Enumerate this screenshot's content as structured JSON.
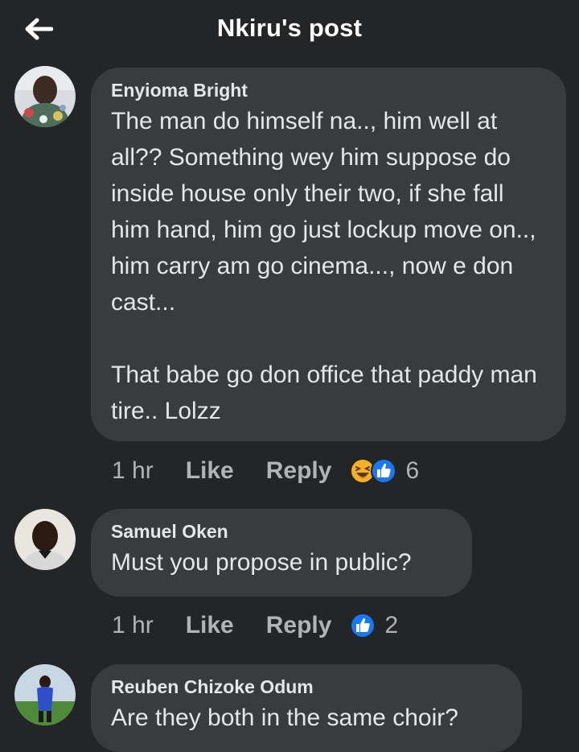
{
  "header": {
    "title": "Nkiru's post",
    "back_icon": "arrow-left-icon"
  },
  "colors": {
    "background": "#242527",
    "bubble": "#3a3b3d",
    "text": "#e4e6eb",
    "muted": "#b0b3b8",
    "like_blue": "#1877f2",
    "haha_yellow": "#f7b125"
  },
  "comments": [
    {
      "author": "Enyioma Bright",
      "text": "The man do himself na.., him well at all?? Something wey him suppose do inside house only their two, if she fall him hand, him go just lockup move on.., him carry am go cinema..., now e don cast...\n\nThat babe go don office that paddy man tire.. Lolzz",
      "time": "1 hr",
      "like_label": "Like",
      "reply_label": "Reply",
      "reactions": [
        "haha-icon",
        "like-icon"
      ],
      "reaction_count": "6"
    },
    {
      "author": "Samuel Oken",
      "text": "Must you propose in public?",
      "time": "1 hr",
      "like_label": "Like",
      "reply_label": "Reply",
      "reactions": [
        "like-icon"
      ],
      "reaction_count": "2"
    },
    {
      "author": "Reuben Chizoke Odum",
      "text": "Are they both in the same choir?",
      "reactions": []
    }
  ]
}
